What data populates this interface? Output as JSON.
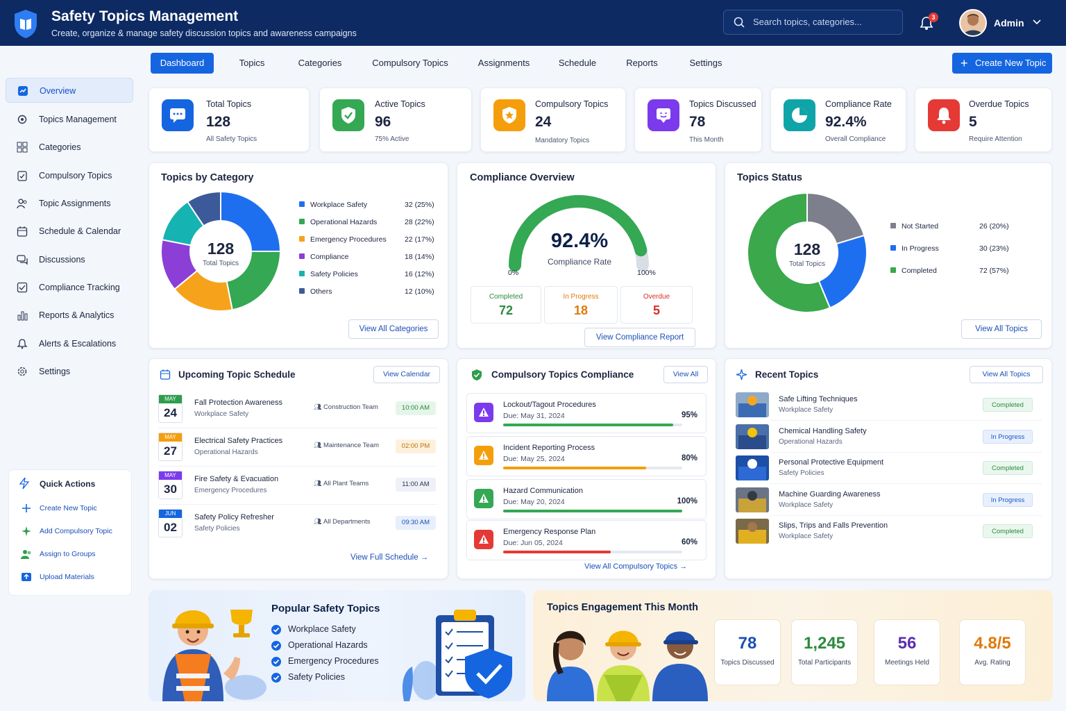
{
  "header": {
    "title": "Safety Topics Management",
    "subtitle": "Create, organize & manage safety discussion topics and awareness campaigns",
    "search_placeholder": "Search topics, categories...",
    "notifications": "3",
    "user": "Admin"
  },
  "tabs": [
    "Dashboard",
    "Topics",
    "Categories",
    "Compulsory Topics",
    "Assignments",
    "Schedule",
    "Reports",
    "Settings"
  ],
  "create_button": "Create New Topic",
  "sidebar": {
    "items": [
      "Overview",
      "Topics Management",
      "Categories",
      "Compulsory Topics",
      "Topic Assignments",
      "Schedule & Calendar",
      "Discussions",
      "Compliance Tracking",
      "Reports & Analytics",
      "Alerts & Escalations",
      "Settings"
    ]
  },
  "quick_actions": {
    "title": "Quick Actions",
    "items": [
      "Create New Topic",
      "Add Compulsory Topic",
      "Assign to Groups",
      "Upload Materials"
    ]
  },
  "stats": [
    {
      "label": "Total Topics",
      "value": "128",
      "sub": "All Safety Topics",
      "color": "#1565e0",
      "icon": "chat-icon"
    },
    {
      "label": "Active Topics",
      "value": "96",
      "sub": "75% Active",
      "color": "#34a853",
      "icon": "shield-check-icon"
    },
    {
      "label": "Compulsory Topics",
      "value": "24",
      "sub": "Mandatory Topics",
      "color": "#f59e0b",
      "icon": "shield-icon"
    },
    {
      "label": "Topics Discussed",
      "value": "78",
      "sub": "This Month",
      "color": "#7c3aed",
      "icon": "discussion-icon"
    },
    {
      "label": "Compliance Rate",
      "value": "92.4%",
      "sub": "Overall Compliance",
      "color": "#0fa5a8",
      "icon": "pie-icon"
    },
    {
      "label": "Overdue Topics",
      "value": "5",
      "sub": "Require Attention",
      "color": "#e53935",
      "icon": "alarm-icon"
    }
  ],
  "category_card": {
    "title": "Topics by Category",
    "center_value": "128",
    "center_label": "Total Topics",
    "button": "View All Categories"
  },
  "compliance_card": {
    "title": "Compliance Overview",
    "value": "92.4%",
    "label": "Compliance Rate",
    "min": "0%",
    "max": "100%",
    "completed_label": "Completed",
    "completed": "72",
    "progress_label": "In Progress",
    "progress": "18",
    "overdue_label": "Overdue",
    "overdue": "5",
    "button": "View Compliance Report"
  },
  "status_card": {
    "title": "Topics Status",
    "center_value": "128",
    "center_label": "Total Topics",
    "button": "View All Topics"
  },
  "chart_data": [
    {
      "type": "pie",
      "title": "Topics by Category",
      "categories": [
        "Workplace Safety",
        "Operational Hazards",
        "Emergency Procedures",
        "Compliance",
        "Safety Policies",
        "Others"
      ],
      "values": [
        32,
        28,
        22,
        18,
        16,
        12
      ],
      "value_labels": [
        "32 (25%)",
        "28 (22%)",
        "22 (17%)",
        "18 (14%)",
        "16 (12%)",
        "12 (10%)"
      ],
      "colors": [
        "#1e6ff0",
        "#34a853",
        "#f7a21b",
        "#8b3fd6",
        "#16b3b3",
        "#3c5a9a"
      ]
    },
    {
      "type": "pie",
      "title": "Topics Status",
      "categories": [
        "Not Started",
        "In Progress",
        "Completed"
      ],
      "values": [
        26,
        30,
        72
      ],
      "value_labels": [
        "26 (20%)",
        "30 (23%)",
        "72 (57%)"
      ],
      "colors": [
        "#7d7f8c",
        "#1e6ff0",
        "#3aa84b"
      ]
    },
    {
      "type": "gauge",
      "title": "Compliance Overview",
      "value": 92.4,
      "ylim": [
        0,
        100
      ]
    }
  ],
  "schedule": {
    "title": "Upcoming Topic Schedule",
    "button": "View Calendar",
    "footer": "View Full Schedule",
    "rows": [
      {
        "month": "MAY",
        "day": "24",
        "title": "Fall Protection Awareness",
        "category": "Workplace Safety",
        "team": "Construction Team",
        "time": "10:00 AM",
        "color": "#2e9e4c",
        "pill_bg": "#e6f5ea",
        "pill_fg": "#2b8a3e"
      },
      {
        "month": "MAY",
        "day": "27",
        "title": "Electrical Safety Practices",
        "category": "Operational Hazards",
        "team": "Maintenance Team",
        "time": "02:00 PM",
        "color": "#f59e0b",
        "pill_bg": "#fdf1dd",
        "pill_fg": "#c0700b"
      },
      {
        "month": "MAY",
        "day": "30",
        "title": "Fire Safety & Evacuation",
        "category": "Emergency Procedures",
        "team": "All Plant Teams",
        "time": "11:00 AM",
        "color": "#7c3aed",
        "pill_bg": "#eef1f6",
        "pill_fg": "#2c3650"
      },
      {
        "month": "JUN",
        "day": "02",
        "title": "Safety Policy Refresher",
        "category": "Safety Policies",
        "team": "All Departments",
        "time": "09:30 AM",
        "color": "#1565e0",
        "pill_bg": "#e7effc",
        "pill_fg": "#1a4fb7"
      }
    ]
  },
  "compulsory": {
    "title": "Compulsory Topics Compliance",
    "button": "View All",
    "footer": "View All Compulsory Topics",
    "rows": [
      {
        "title": "Lockout/Tagout Procedures",
        "due": "Due: May 31, 2024",
        "percent": "95%",
        "value": 95,
        "color": "#34a853",
        "icon_color": "#7c3aed"
      },
      {
        "title": "Incident Reporting Process",
        "due": "Due: May 25, 2024",
        "percent": "80%",
        "value": 80,
        "color": "#f59e0b",
        "icon_color": "#f59e0b"
      },
      {
        "title": "Hazard Communication",
        "due": "Due: May 20, 2024",
        "percent": "100%",
        "value": 100,
        "color": "#34a853",
        "icon_color": "#34a853"
      },
      {
        "title": "Emergency Response Plan",
        "due": "Due: Jun 05, 2024",
        "percent": "60%",
        "value": 60,
        "color": "#e53935",
        "icon_color": "#e53935"
      }
    ]
  },
  "recent": {
    "title": "Recent Topics",
    "button": "View All Topics",
    "rows": [
      {
        "title": "Safe Lifting Techniques",
        "category": "Workplace Safety",
        "status": "Completed"
      },
      {
        "title": "Chemical Handling Safety",
        "category": "Operational Hazards",
        "status": "In Progress"
      },
      {
        "title": "Personal Protective Equipment",
        "category": "Safety Policies",
        "status": "Completed"
      },
      {
        "title": "Machine Guarding Awareness",
        "category": "Workplace Safety",
        "status": "In Progress"
      },
      {
        "title": "Slips, Trips and Falls Prevention",
        "category": "Workplace Safety",
        "status": "Completed"
      }
    ]
  },
  "popular": {
    "title": "Popular Safety Topics",
    "items": [
      "Workplace Safety",
      "Operational Hazards",
      "Emergency Procedures",
      "Safety Policies"
    ]
  },
  "engagement": {
    "title": "Topics Engagement This Month",
    "cards": [
      {
        "value": "78",
        "label": "Topics Discussed",
        "color": "#1a4fb7"
      },
      {
        "value": "1,245",
        "label": "Total Participants",
        "color": "#2b8a3e"
      },
      {
        "value": "56",
        "label": "Meetings Held",
        "color": "#5b2fb0"
      },
      {
        "value": "4.8/5",
        "label": "Avg. Rating",
        "color": "#e07a0b"
      }
    ]
  }
}
